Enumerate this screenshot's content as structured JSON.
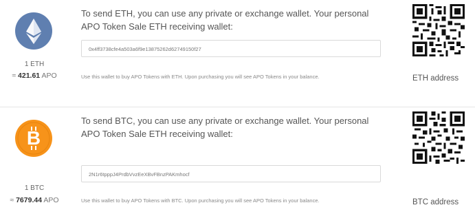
{
  "eth": {
    "amount": "1 ETH",
    "rate_prefix": "≈ ",
    "rate_value": "421.61",
    "rate_unit": " APO",
    "instructions": "To send ETH, you can use any private or exchange wallet. Your personal APO Token Sale ETH receiving wallet:",
    "address": "0x4ff3738cfe4a503a6f9e13875262d62749150f27",
    "note": "Use this wallet to buy APO Tokens with ETH. Upon purchasing you will see APO Tokens in your balance.",
    "qr_label": "ETH address",
    "icon": "ethereum-icon",
    "color": "#5f7fb0"
  },
  "btc": {
    "amount": "1 BTC",
    "rate_prefix": "≈ ",
    "rate_value": "7679.44",
    "rate_unit": " APO",
    "instructions": "To send BTC, you can use any private or exchange wallet. Your personal APO Token Sale ETH receiving wallet:",
    "address": "2N1r6tpppJ4PrdbVvzEeXBvFBnzPAKmhocf",
    "note": "Use this wallet to buy APO Tokens with BTC. Upon purchasing you will see APO Tokens in your balance.",
    "qr_label": "BTC address",
    "icon": "bitcoin-icon",
    "color": "#f7931a"
  }
}
